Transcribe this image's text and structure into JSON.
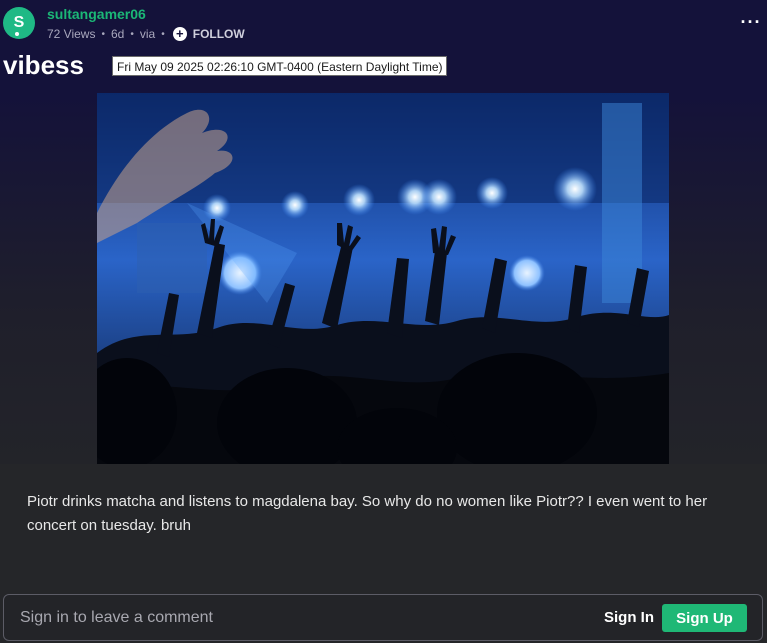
{
  "post": {
    "avatar_letter": "S",
    "username": "sultangamer06",
    "views": "72 Views",
    "age": "6d",
    "via": "via",
    "follow_label": "FOLLOW",
    "title": "vibess",
    "tooltip": "Fri May 09 2025 02:26:10 GMT-0400 (Eastern Daylight Time)",
    "more_icon": "more-horizontal-icon",
    "image_subject": "concert crowd with raised hands under blue stage lights",
    "caption": "Piotr drinks matcha and listens to magdalena bay. So why do no women like Piotr?? I even went to her concert on tuesday. bruh"
  },
  "comments": {
    "prompt": "Sign in to leave a comment",
    "sign_in_label": "Sign In",
    "sign_up_label": "Sign Up"
  },
  "colors": {
    "header_bg": "#14123a",
    "page_bg": "#252629",
    "accent_green": "#1fb876",
    "avatar_green": "#1fb985"
  }
}
